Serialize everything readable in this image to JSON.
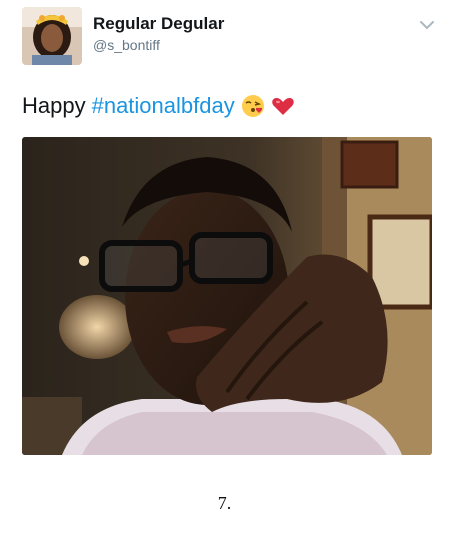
{
  "user": {
    "display_name": "Regular Degular",
    "handle": "@s_bontiff"
  },
  "tweet": {
    "text_prefix": "Happy",
    "hashtag": "#nationalbfday",
    "emojis": [
      "face-blowing-kiss-icon",
      "red-heart-icon"
    ]
  },
  "caption": "7.",
  "colors": {
    "hashtag": "#1b95e0",
    "handle": "#657786",
    "name": "#14171a"
  }
}
